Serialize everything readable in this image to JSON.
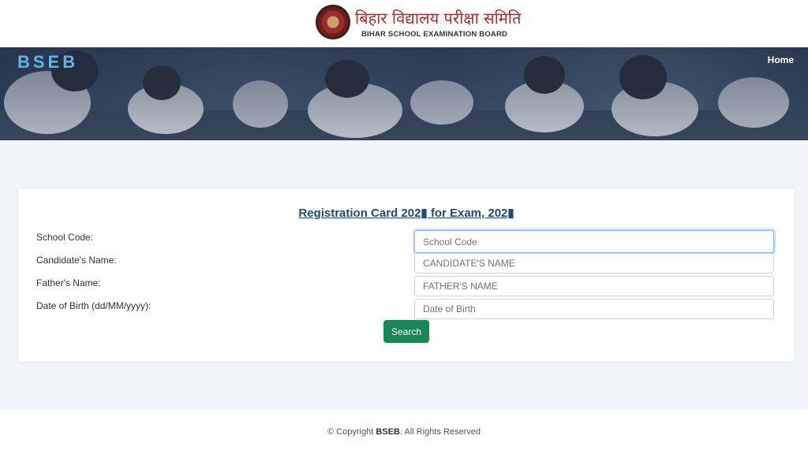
{
  "brand": {
    "hindi_name": "बिहार विद्यालय परीक्षा समिति",
    "english_name": "BIHAR SCHOOL EXAMINATION BOARD"
  },
  "hero": {
    "title": "BSEB",
    "nav": {
      "home_label": "Home"
    }
  },
  "form": {
    "title": "Registration Card 202▮ for Exam, 202▮",
    "fields": [
      {
        "label": "School Code:",
        "placeholder": "School Code",
        "value": ""
      },
      {
        "label": "Candidate's Name:",
        "placeholder": "CANDIDATE'S NAME",
        "value": ""
      },
      {
        "label": "Father's Name:",
        "placeholder": "FATHER'S NAME",
        "value": ""
      },
      {
        "label": "Date of Birth (dd/MM/yyyy):",
        "placeholder": "Date of Birth",
        "value": ""
      }
    ],
    "search_label": "Search"
  },
  "footer": {
    "prefix": "© Copyright ",
    "brand": "BSEB",
    "suffix": ". All Rights Reserved"
  },
  "colors": {
    "brand_red": "#b22a2a",
    "hero_title": "#5fb4e8",
    "form_title": "#1f4a7a",
    "search_button": "#198754",
    "page_background": "#f1f4f9"
  },
  "icons": {
    "logo": "bseb-seal-icon"
  }
}
